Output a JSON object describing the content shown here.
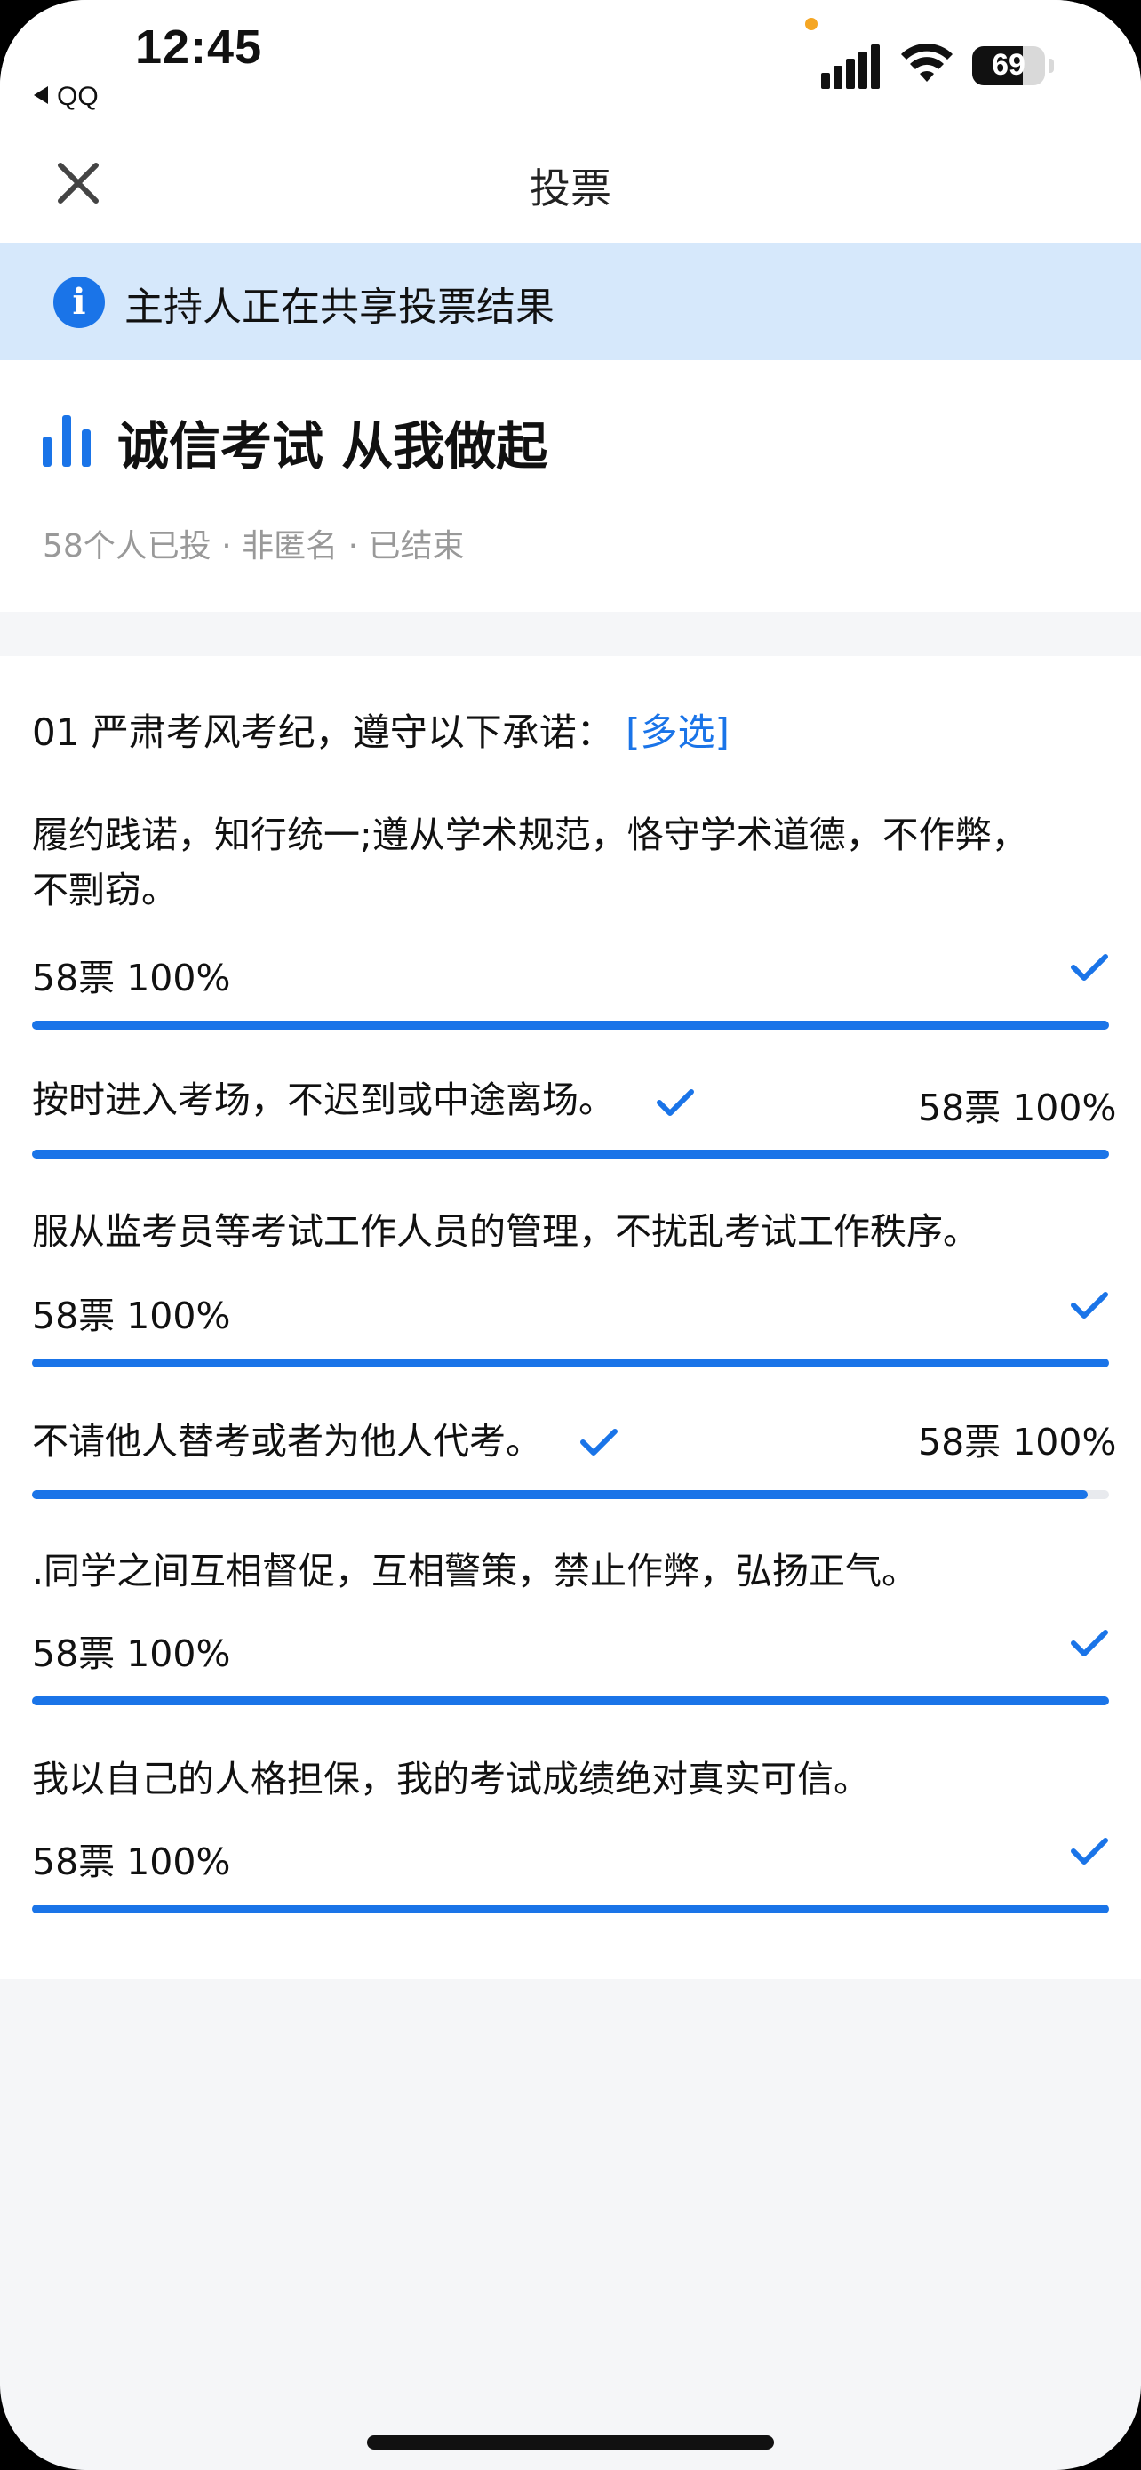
{
  "status_bar": {
    "time": "12:45",
    "back_app": "QQ",
    "battery": "69"
  },
  "nav": {
    "title": "投票"
  },
  "banner": {
    "text": "主持人正在共享投票结果"
  },
  "poll": {
    "title": "诚信考试 从我做起",
    "meta": "58个人已投 · 非匿名 · 已结束"
  },
  "question": {
    "text": "01 严肃考风考纪，遵守以下承诺：",
    "tag": "[多选]"
  },
  "options": [
    {
      "text": "履约践诺，知行统一;遵从学术规范，恪守学术道德，不作弊，不剽窃。",
      "votes": "58票 100%",
      "selected": true,
      "percent": 100
    },
    {
      "text": "按时进入考场，不迟到或中途离场。",
      "votes": "58票 100%",
      "selected": true,
      "percent": 100
    },
    {
      "text": "服从监考员等考试工作人员的管理，不扰乱考试工作秩序。",
      "votes": "58票 100%",
      "selected": true,
      "percent": 100
    },
    {
      "text": "不请他人替考或者为他人代考。",
      "votes": "58票 100%",
      "selected": true,
      "percent": 100
    },
    {
      "text": ".同学之间互相督促，互相警策，禁止作弊，弘扬正气。",
      "votes": "58票 100%",
      "selected": true,
      "percent": 100
    },
    {
      "text": "我以自己的人格担保，我的考试成绩绝对真实可信。",
      "votes": "58票 100%",
      "selected": true,
      "percent": 100
    }
  ],
  "colors": {
    "accent": "#1a74e8",
    "banner_bg": "#d6e8fb"
  }
}
